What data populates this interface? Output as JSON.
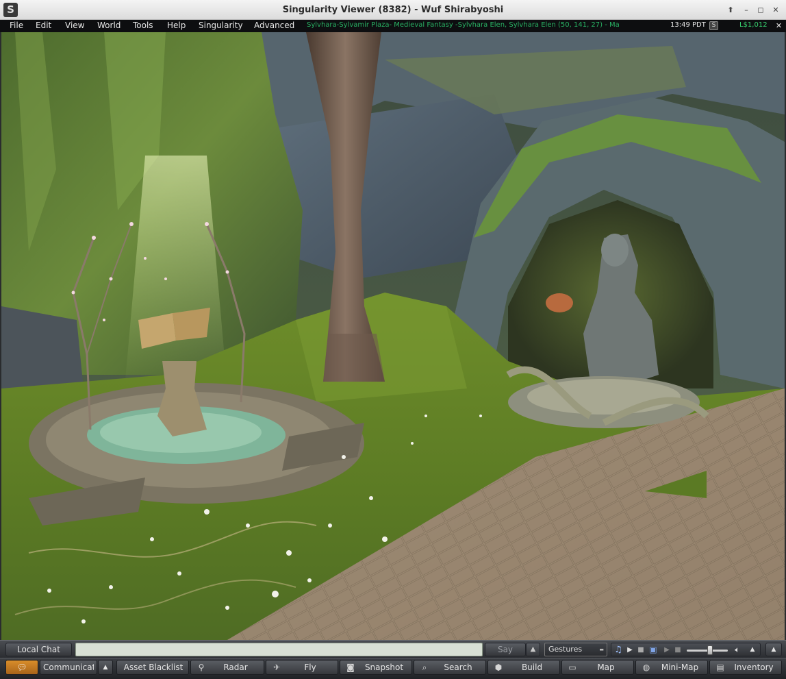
{
  "window": {
    "title": "Singularity Viewer (8382) - Wuf Shirabyoshi",
    "buttons": [
      "keep-above",
      "minimize",
      "maximize",
      "close"
    ]
  },
  "menu": {
    "items": [
      "File",
      "Edit",
      "View",
      "World",
      "Tools",
      "Help",
      "Singularity",
      "Advanced"
    ],
    "location": "Sylvhara-Sylvamir Plaza- Medieval Fantasy -Sylvhara Elen, Sylvhara Elen (50, 141, 27) - Ma",
    "clock": "13:49 PDT",
    "buy_currency_icon": "S",
    "balance": "L$1,012"
  },
  "chat": {
    "local_chat_label": "Local Chat",
    "input_value": "",
    "say_label": "Say",
    "gestures_label": "Gestures"
  },
  "media": {
    "volume_level": 0.57,
    "icons": [
      "music-note-icon",
      "play-icon",
      "stop-icon",
      "media-icon",
      "play-icon",
      "stop-icon",
      "speaker-icon"
    ]
  },
  "toolbar": {
    "communicate": "Communicat",
    "asset_blacklist": "Asset Blacklist",
    "radar": "Radar",
    "fly": "Fly",
    "snapshot": "Snapshot",
    "search": "Search",
    "build": "Build",
    "map": "Map",
    "minimap": "Mini-Map",
    "inventory": "Inventory"
  },
  "colors": {
    "location_text": "#29b364",
    "balance_text": "#38d16f",
    "chat_history_accent": "#d98e2a",
    "menubar_bg": "#0d0e10"
  }
}
